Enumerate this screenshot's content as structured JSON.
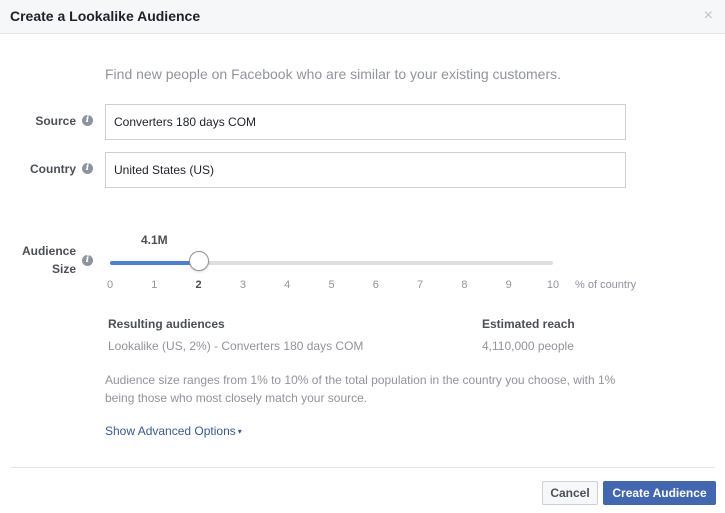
{
  "dialog": {
    "title": "Create a Lookalike Audience",
    "close_glyph": "×"
  },
  "subtitle": "Find new people on Facebook who are similar to your existing customers.",
  "form": {
    "source": {
      "label": "Source",
      "value": "Converters 180 days COM"
    },
    "country": {
      "label": "Country",
      "value": "United States (US)"
    }
  },
  "audience_size": {
    "label_line1": "Audience",
    "label_line2": "Size",
    "reach_value": "4.1M",
    "slider_value": 2,
    "slider_min": 0,
    "slider_max": 10,
    "ticks": [
      "0",
      "1",
      "2",
      "3",
      "4",
      "5",
      "6",
      "7",
      "8",
      "9",
      "10"
    ],
    "unit": "% of country"
  },
  "results": {
    "resulting_header": "Resulting audiences",
    "resulting_value": "Lookalike (US, 2%) - Converters 180 days COM",
    "reach_header": "Estimated reach",
    "reach_value": "4,110,000 people"
  },
  "note": "Audience size ranges from 1% to 10% of the total population in the country you choose, with 1% being those who most closely match your source.",
  "advanced": {
    "label": "Show Advanced Options",
    "caret": "▾"
  },
  "footer": {
    "cancel_label": "Cancel",
    "create_label": "Create Audience"
  },
  "colors": {
    "accent": "#4267b2",
    "slider_fill": "#4a7ee3",
    "link": "#365899"
  }
}
